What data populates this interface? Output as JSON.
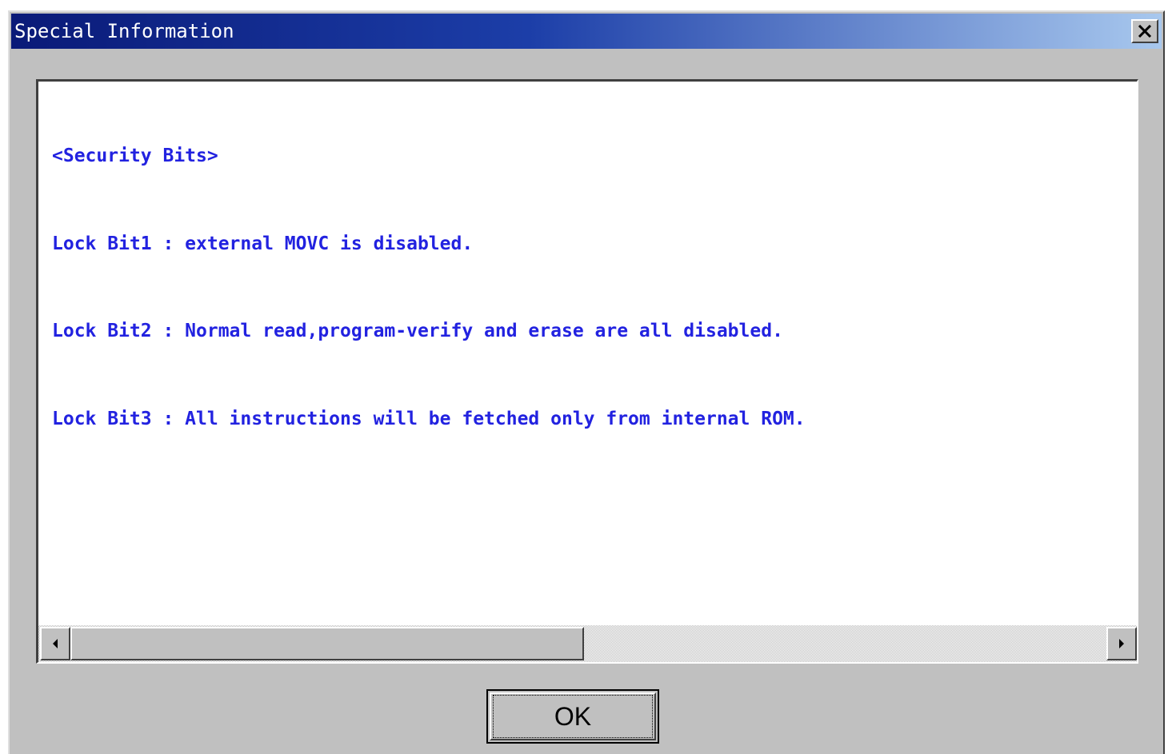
{
  "window": {
    "title": "Special Information",
    "close_icon": "close-icon"
  },
  "content": {
    "lines": [
      "<Security Bits>",
      "Lock Bit1 : external MOVC is disabled.",
      "Lock Bit2 : Normal read,program-verify and erase are all disabled.",
      "Lock Bit3 : All instructions will be fetched only from internal ROM."
    ],
    "text_color": "#2222e0"
  },
  "scrollbar": {
    "left_icon": "scroll-left-arrow-icon",
    "right_icon": "scroll-right-arrow-icon"
  },
  "buttons": {
    "ok_label": "OK"
  },
  "colors": {
    "titlebar_start": "#0a1a78",
    "titlebar_end": "#a8c8ee",
    "dialog_face": "#c0c0c0"
  }
}
